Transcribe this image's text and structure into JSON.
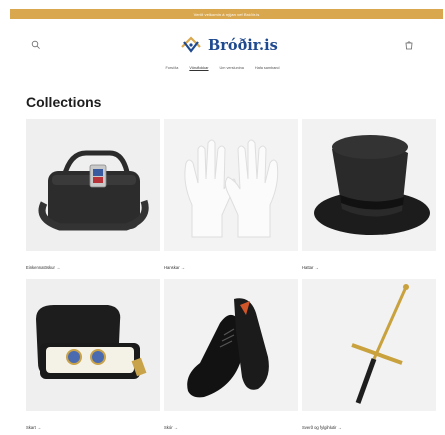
{
  "announcement": "Verið velkomin á nýjan vef Bróðir.is",
  "brand": {
    "name": "Bróðir.is",
    "accent": "#d9a84e",
    "logo_blue": "#1f4a8f"
  },
  "icons": {
    "search": "search-icon",
    "cart": "cart-icon"
  },
  "nav": [
    {
      "label": "Forsíða"
    },
    {
      "label": "Vöruflokkar"
    },
    {
      "label": "Um verslunina"
    },
    {
      "label": "Hafa samband"
    }
  ],
  "section_title": "Collections",
  "collections": [
    {
      "label": "Einkennatöskur →"
    },
    {
      "label": "Hanskar →"
    },
    {
      "label": "Hattar →"
    },
    {
      "label": "Skart →"
    },
    {
      "label": "Skór →"
    },
    {
      "label": "Sverð og fylgihlutir →"
    }
  ]
}
